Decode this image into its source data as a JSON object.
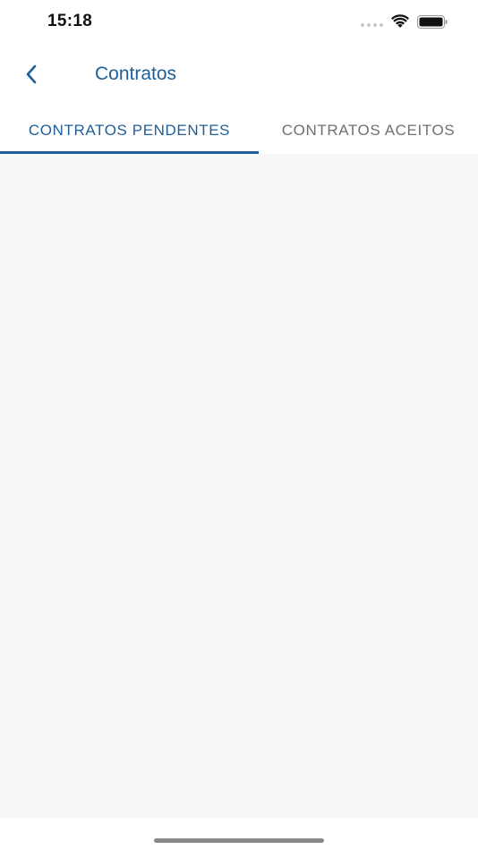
{
  "status_bar": {
    "time": "15:18"
  },
  "header": {
    "title": "Contratos",
    "back_icon": "chevron-left-icon"
  },
  "tabs": [
    {
      "label": "CONTRATOS PENDENTES",
      "selected": true
    },
    {
      "label": "CONTRATOS ACEITOS",
      "selected": false
    }
  ],
  "colors": {
    "accent": "#1f5f99",
    "inactive_tab": "#707070",
    "content_background": "#f8f8f8"
  }
}
